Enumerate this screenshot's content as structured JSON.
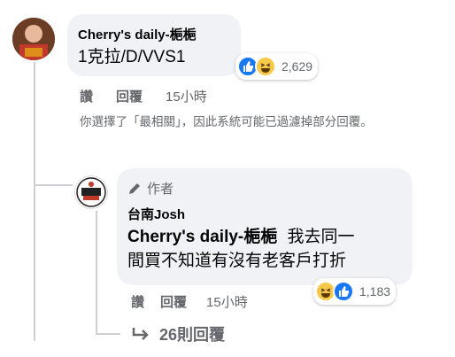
{
  "comment": {
    "author": "Cherry's daily-梔梔",
    "text": "1克拉/D/VVS1",
    "reaction_count": "2,629",
    "like_label": "讚",
    "reply_label": "回覆",
    "time": "15小時",
    "notice": "你選擇了「最相關」，因此系統可能已過濾掉部分回覆。"
  },
  "reply": {
    "author_tag": "作者",
    "author": "台南Josh",
    "mention": "Cherry's daily-梔梔",
    "text_line1": "我去同一",
    "text_line2": "間買不知道有沒有老客戶打折",
    "reaction_count": "1,183",
    "like_label": "讚",
    "reply_label": "回覆",
    "time": "15小時"
  },
  "view_replies": {
    "label": "26則回覆"
  },
  "colors": {
    "bubble": "#f0f2f5",
    "secondary_text": "#65676b",
    "like_blue": "#1877f2",
    "haha_yellow": "#f7c94a"
  }
}
